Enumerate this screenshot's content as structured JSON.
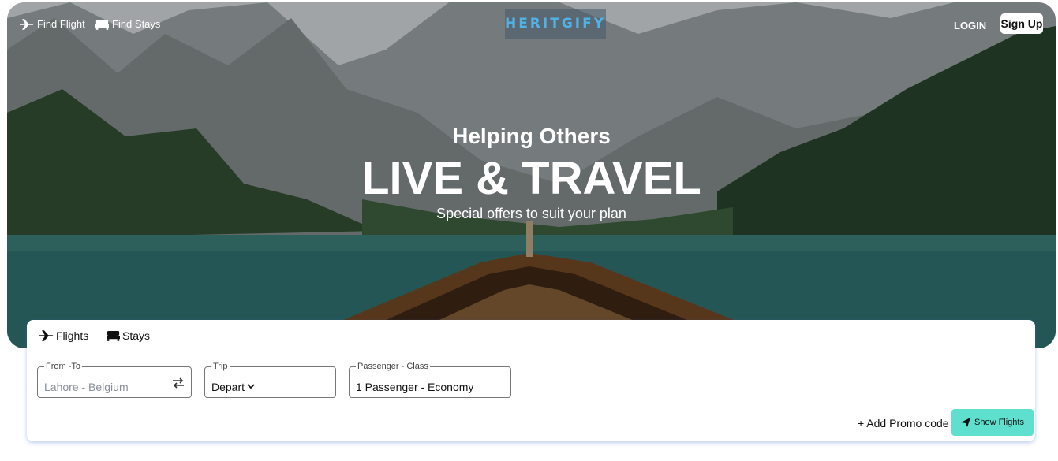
{
  "nav": {
    "find_flight": "Find Flight",
    "find_stays": "Find Stays",
    "logo_text": "HERITGIFY",
    "login": "LOGIN",
    "signup": "Sign Up"
  },
  "hero": {
    "subtitle": "Helping Others",
    "title": "LIVE & TRAVEL",
    "tagline": "Special offers to suit your plan"
  },
  "search": {
    "tabs": [
      {
        "label": "Flights",
        "icon": "airplane-icon"
      },
      {
        "label": "Stays",
        "icon": "bed-icon"
      }
    ],
    "from_to": {
      "legend": "From -To",
      "placeholder": "Lahore - Belgium"
    },
    "trip": {
      "legend": "Trip",
      "value": "Depart"
    },
    "passenger": {
      "legend": "Passenger - Class",
      "value": "1 Passenger - Economy"
    },
    "promo": "+ Add Promo code",
    "show_flights": "Show Flights"
  },
  "colors": {
    "accent": "#5fe0cf",
    "logo": "#4fb3e8"
  }
}
